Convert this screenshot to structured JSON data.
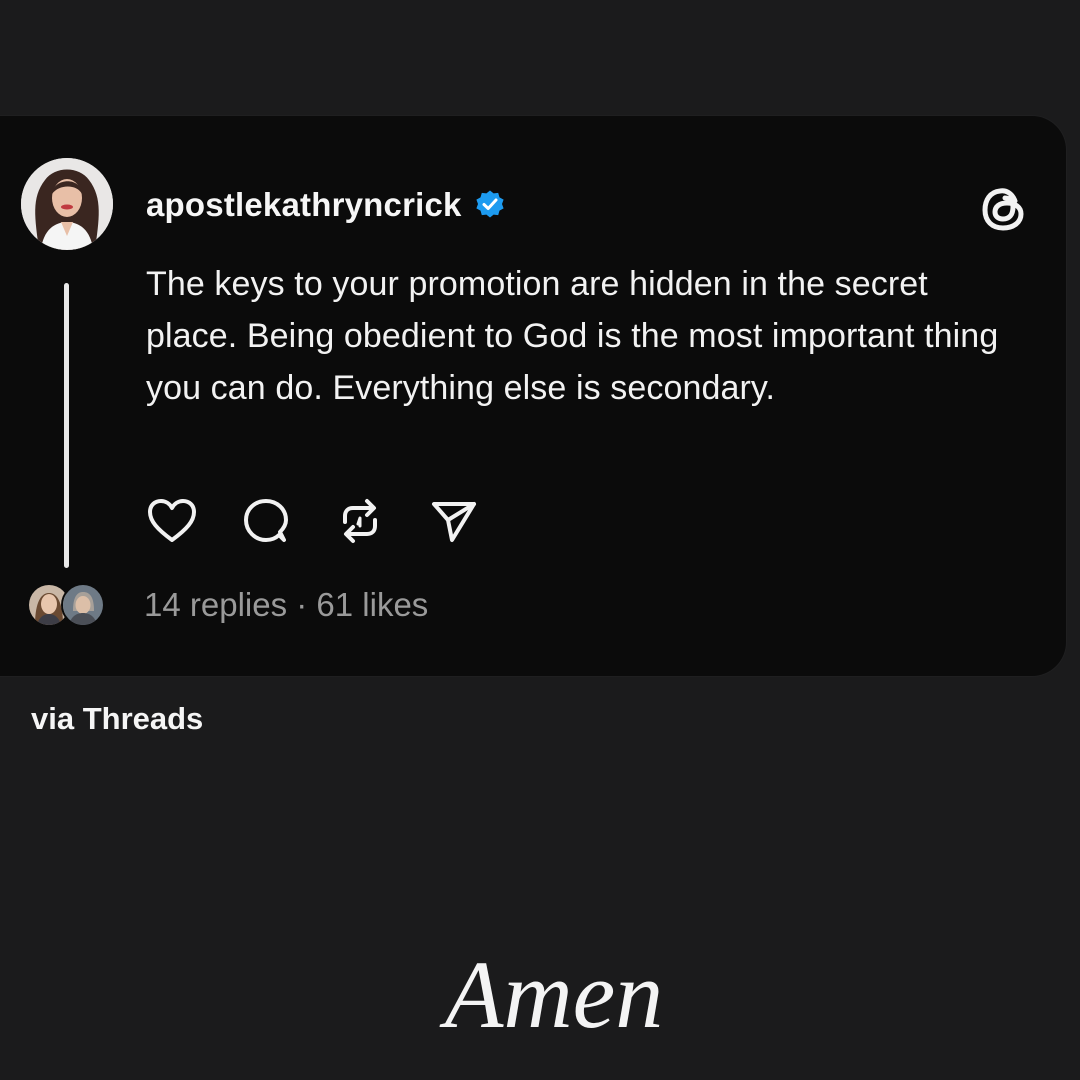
{
  "post": {
    "username": "apostlekathryncrick",
    "verified_icon": "verified-badge-icon",
    "app_icon": "threads-logo-icon",
    "text": "The keys to your promotion are hidden in the secret place. Being obedient to God is the most important thing you can do. Everything else is secondary.",
    "actions": [
      {
        "name": "like",
        "icon": "heart-icon"
      },
      {
        "name": "reply",
        "icon": "comment-icon"
      },
      {
        "name": "repost",
        "icon": "repost-icon"
      },
      {
        "name": "share",
        "icon": "send-icon"
      }
    ],
    "stats": "14 replies · 61 likes"
  },
  "caption": {
    "source": "via Threads",
    "signoff": "Amen"
  },
  "colors": {
    "background": "#1b1b1c",
    "card": "#0b0b0b",
    "verified": "#1d9bf0",
    "muted_text": "#9a9a9a"
  }
}
